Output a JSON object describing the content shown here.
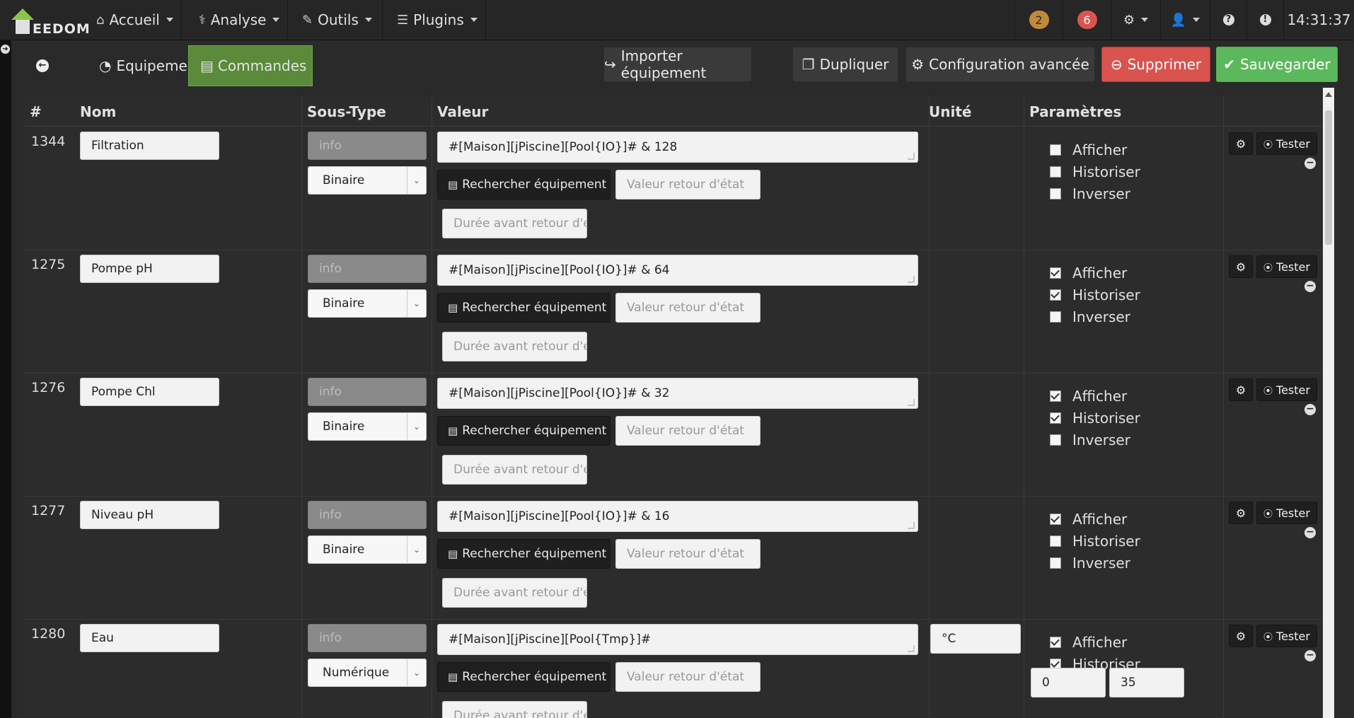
{
  "topbar": {
    "logo_text": "EEDOM",
    "menu": [
      {
        "label": "Accueil",
        "icon": "home-icon"
      },
      {
        "label": "Analyse",
        "icon": "stethoscope-icon"
      },
      {
        "label": "Outils",
        "icon": "wrench-icon"
      },
      {
        "label": "Plugins",
        "icon": "list-icon"
      }
    ],
    "badge_warning": "2",
    "badge_alert": "6",
    "clock": "14:31:37"
  },
  "subbar": {
    "tab_equipement": "Equipement",
    "tab_commandes": "Commandes",
    "btn_importer": "Importer équipement",
    "btn_dupliquer": "Dupliquer",
    "btn_config": "Configuration avancée",
    "btn_supprimer": "Supprimer",
    "btn_sauvegarder": "Sauvegarder"
  },
  "colors": {
    "active_tab": "#5a8a3a",
    "delete": "#d9534f",
    "save": "#5cb85c"
  },
  "table": {
    "headers": {
      "id": "#",
      "nom": "Nom",
      "soustype": "Sous-Type",
      "valeur": "Valeur",
      "unite": "Unité",
      "params": "Paramètres"
    },
    "search_btn": "Rechercher équipement",
    "retour_placeholder": "Valeur retour d'état",
    "duree_placeholder": "Durée avant retour d'é",
    "afficher": "Afficher",
    "historiser": "Historiser",
    "inverser": "Inverser",
    "tester": "Tester",
    "rows": [
      {
        "id": "1344",
        "nom": "Filtration",
        "type": "info",
        "subtype": "Binaire",
        "valeur": "#[Maison][jPiscine][Pool{IO}]# & 128",
        "unite": "",
        "afficher": false,
        "historiser": false,
        "inverser": false
      },
      {
        "id": "1275",
        "nom": "Pompe pH",
        "type": "info",
        "subtype": "Binaire",
        "valeur": "#[Maison][jPiscine][Pool{IO}]# & 64",
        "unite": "",
        "afficher": true,
        "historiser": true,
        "inverser": false
      },
      {
        "id": "1276",
        "nom": "Pompe Chl",
        "type": "info",
        "subtype": "Binaire",
        "valeur": "#[Maison][jPiscine][Pool{IO}]# & 32",
        "unite": "",
        "afficher": true,
        "historiser": true,
        "inverser": false
      },
      {
        "id": "1277",
        "nom": "Niveau pH",
        "type": "info",
        "subtype": "Binaire",
        "valeur": "#[Maison][jPiscine][Pool{IO}]# & 16",
        "unite": "",
        "afficher": true,
        "historiser": false,
        "inverser": false
      },
      {
        "id": "1280",
        "nom": "Eau",
        "type": "info",
        "subtype": "Numérique",
        "valeur": "#[Maison][jPiscine][Pool{Tmp}]#",
        "unite": "°C",
        "afficher": true,
        "historiser": true,
        "min": "0",
        "max": "35"
      }
    ]
  }
}
